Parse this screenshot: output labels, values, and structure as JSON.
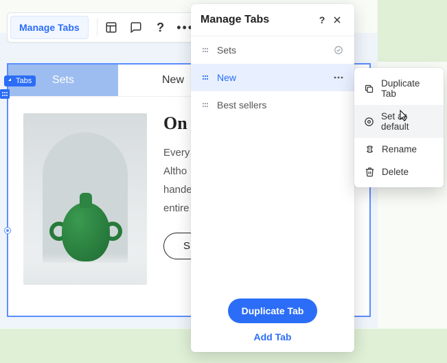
{
  "toolbar": {
    "manage_label": "Manage Tabs"
  },
  "chip": {
    "label": "Tabs"
  },
  "tabs_preview": {
    "tab1": "Sets",
    "tab2": "New",
    "heading_partial": "On",
    "body_lines": "Every\nAltho\nhande\nentire",
    "cta_partial": "S"
  },
  "panel": {
    "title": "Manage Tabs",
    "rows": {
      "r0": "Sets",
      "r1": "New",
      "r2": "Best sellers"
    },
    "actions": {
      "primary": "Duplicate Tab",
      "secondary": "Add Tab"
    }
  },
  "context_menu": {
    "i0": "Duplicate Tab",
    "i1": "Set as default",
    "i2": "Rename",
    "i3": "Delete"
  }
}
